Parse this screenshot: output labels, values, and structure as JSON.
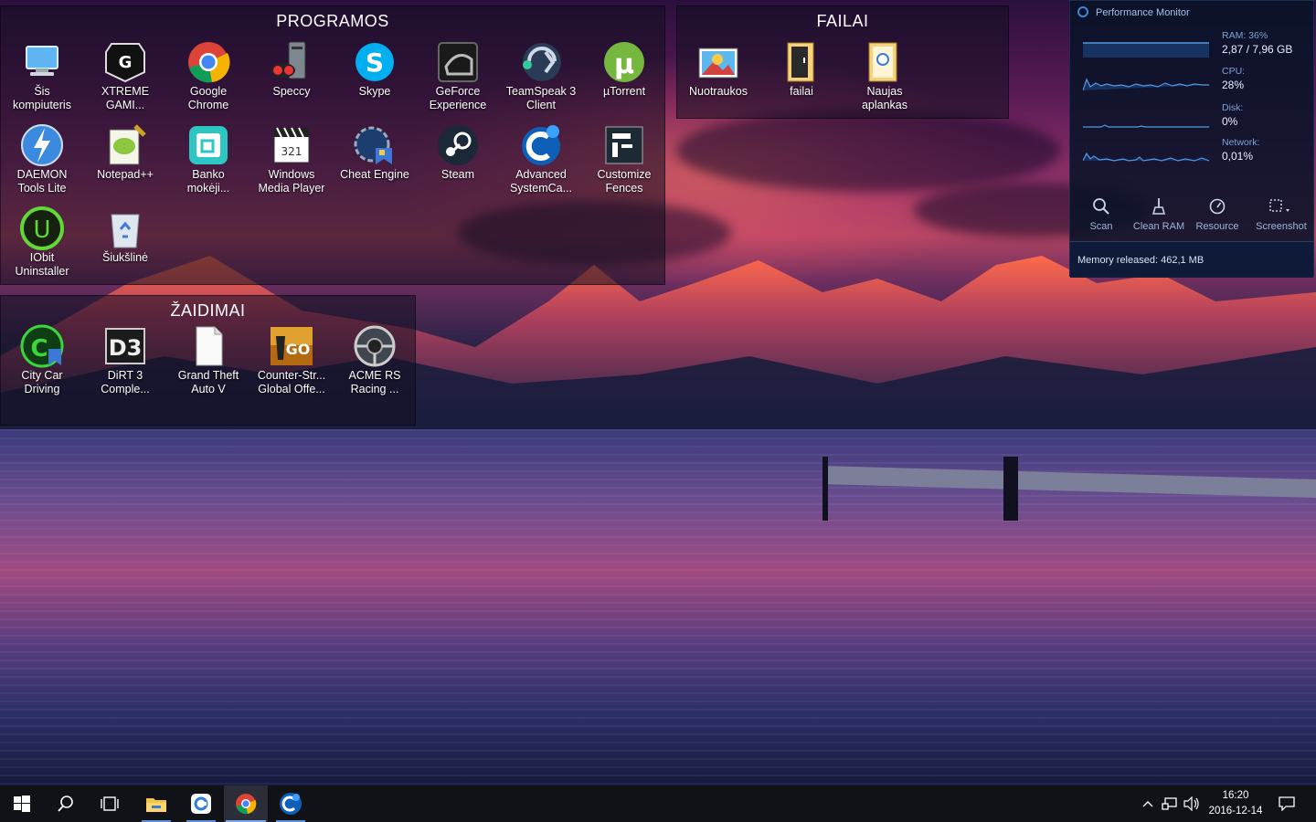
{
  "fences": {
    "programos": {
      "title": "PROGRAMOS",
      "items": [
        {
          "label": "Šis\nkompiuteris",
          "icon": "this-pc-icon"
        },
        {
          "label": "XTREME\nGAMI...",
          "icon": "gigabyte-xtreme-icon"
        },
        {
          "label": "Google\nChrome",
          "icon": "chrome-icon"
        },
        {
          "label": "Speccy",
          "icon": "speccy-icon"
        },
        {
          "label": "Skype",
          "icon": "skype-icon"
        },
        {
          "label": "GeForce\nExperience",
          "icon": "geforce-icon"
        },
        {
          "label": "TeamSpeak 3\nClient",
          "icon": "teamspeak-icon"
        },
        {
          "label": "µTorrent",
          "icon": "utorrent-icon"
        },
        {
          "label": "DAEMON\nTools Lite",
          "icon": "daemon-tools-icon"
        },
        {
          "label": "Notepad++",
          "icon": "notepadpp-icon"
        },
        {
          "label": "Banko\nmokėji...",
          "icon": "bank-payment-icon"
        },
        {
          "label": "Windows\nMedia Player",
          "icon": "media-player-icon"
        },
        {
          "label": "Cheat Engine",
          "icon": "cheat-engine-icon"
        },
        {
          "label": "Steam",
          "icon": "steam-icon"
        },
        {
          "label": "Advanced\nSystemCa...",
          "icon": "advanced-systemcare-icon"
        },
        {
          "label": "Customize\nFences",
          "icon": "fences-icon"
        },
        {
          "label": "IObit\nUninstaller",
          "icon": "iobit-uninstaller-icon"
        },
        {
          "label": "Šiukšlinė",
          "icon": "recycle-bin-icon"
        }
      ]
    },
    "failai": {
      "title": "FAILAI",
      "items": [
        {
          "label": "Nuotraukos",
          "icon": "photos-icon"
        },
        {
          "label": "failai",
          "icon": "folder-icon"
        },
        {
          "label": "Naujas\naplankas",
          "icon": "new-folder-icon"
        }
      ]
    },
    "zaidimai": {
      "title": "ŽAIDIMAI",
      "items": [
        {
          "label": "City Car\nDriving",
          "icon": "city-car-driving-icon"
        },
        {
          "label": "DiRT 3\nComple...",
          "icon": "dirt3-icon"
        },
        {
          "label": "Grand Theft\nAuto V",
          "icon": "gta-v-icon"
        },
        {
          "label": "Counter-Str...\nGlobal Offe...",
          "icon": "csgo-icon"
        },
        {
          "label": "ACME RS\nRacing ...",
          "icon": "acme-racing-icon"
        }
      ]
    }
  },
  "perf": {
    "title": "Performance Monitor",
    "ram_label": "RAM: 36%",
    "ram_value": "2,87 / 7,96 GB",
    "cpu_label": "CPU:",
    "cpu_value": "28%",
    "disk_label": "Disk:",
    "disk_value": "0%",
    "net_label": "Network:",
    "net_value": "0,01%",
    "buttons": [
      "Scan",
      "Clean RAM",
      "Resource",
      "Screenshot"
    ],
    "message": "Memory released: 462,1 MB",
    "ram_fraction": 0.36,
    "cpu_fraction": 0.28
  },
  "taskbar": {
    "time": "16:20",
    "date": "2016-12-14"
  },
  "colors": {
    "accent": "#3f86d8",
    "panel": "#08122a"
  }
}
